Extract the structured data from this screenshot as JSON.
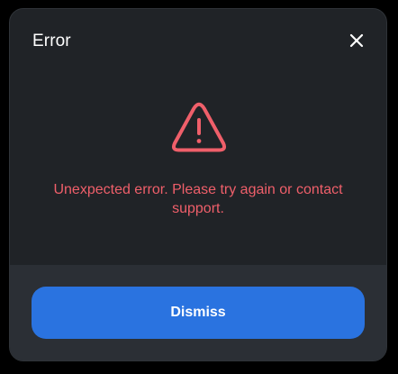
{
  "dialog": {
    "title": "Error",
    "close_icon": "close-icon",
    "warning_icon": "warning-triangle-icon",
    "message": "Unexpected error. Please try again or contact support.",
    "dismiss_label": "Dismiss"
  },
  "colors": {
    "background": "#202327",
    "footer": "#2b2f35",
    "accent": "#2a73e0",
    "error": "#ef5f6a",
    "text": "#ffffff"
  }
}
